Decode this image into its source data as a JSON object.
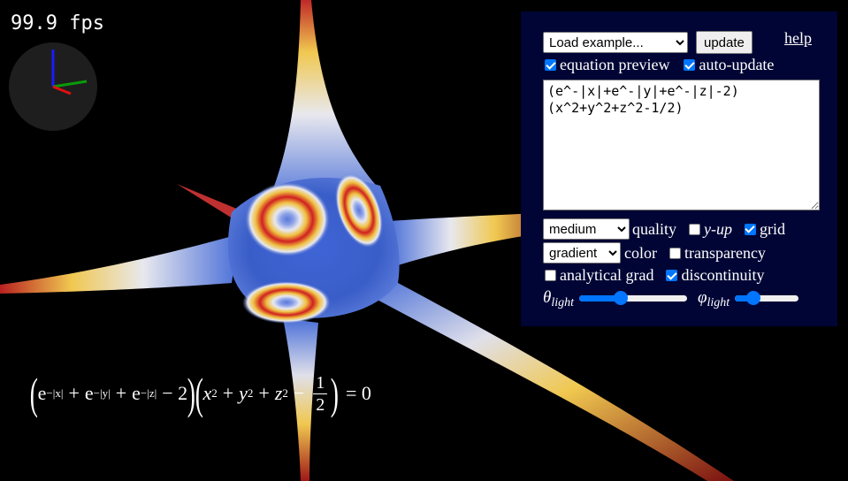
{
  "fps": "99.9 fps",
  "panel": {
    "example_select": "Load example...",
    "update_button": "update",
    "help_link": "help",
    "equation_preview_label": "equation preview",
    "equation_preview_checked": true,
    "auto_update_label": "auto-update",
    "auto_update_checked": true,
    "equation_text": "(e^-|x|+e^-|y|+e^-|z|-2)\n(x^2+y^2+z^2-1/2)",
    "quality_select": "medium",
    "quality_label": "quality",
    "yup_label": "y-up",
    "yup_checked": false,
    "grid_label": "grid",
    "grid_checked": true,
    "color_select": "gradient",
    "color_label": "color",
    "transparency_label": "transparency",
    "transparency_checked": false,
    "analytical_grad_label": "analytical grad",
    "analytical_grad_checked": false,
    "discontinuity_label": "discontinuity",
    "discontinuity_checked": true,
    "theta_label": "θ",
    "theta_sub": "light",
    "theta_value": 0.37,
    "phi_label": "φ",
    "phi_sub": "light",
    "phi_value": 0.22
  },
  "formula": {
    "e": "e",
    "exp_x": "−|x|",
    "exp_y": "−|y|",
    "exp_z": "−|z|",
    "plus": "+",
    "minus2": "− 2",
    "x": "x",
    "y": "y",
    "z": "z",
    "two": "2",
    "minus": "−",
    "num": "1",
    "den": "2",
    "eq": "= 0"
  },
  "colors": {
    "panel_bg": "#000535",
    "accent": "#0075ff",
    "surface_blue": "#3a62d8",
    "surface_red": "#d02020",
    "surface_yellow": "#f0d040"
  }
}
